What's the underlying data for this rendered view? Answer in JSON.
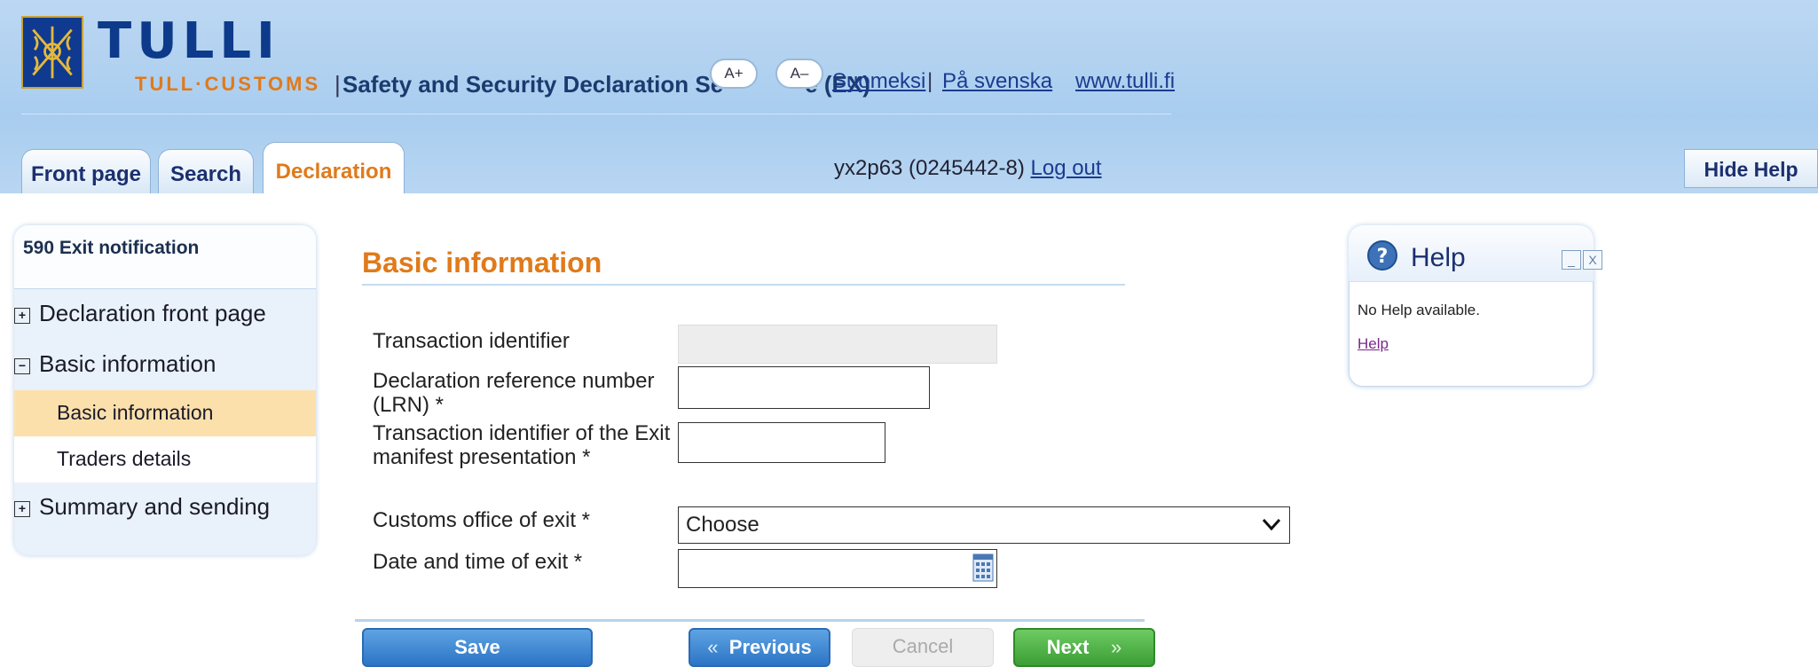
{
  "header": {
    "brand_main": "TULLI",
    "brand_sub": "TULL·CUSTOMS",
    "service_separator": "|",
    "service_title": "Safety and Security Declaration Se",
    "service_title_tail": "e (EX)",
    "font_increase_label": "A+",
    "font_decrease_label": "A–",
    "lang_finnish": "Suomeksi",
    "lang_separator": "|",
    "lang_swedish": "På svenska",
    "site_link": "www.tulli.fi"
  },
  "tabs": [
    {
      "label": "Front page"
    },
    {
      "label": "Search"
    },
    {
      "label": "Declaration"
    }
  ],
  "user": {
    "id_text": "yx2p63 (0245442-8)",
    "logout_label": "Log out"
  },
  "hide_help_label": "Hide Help",
  "sidebar": {
    "title": "590 Exit notification",
    "items": [
      {
        "label": "Declaration front page",
        "expander": "+"
      },
      {
        "label": "Basic information",
        "expander": "−"
      },
      {
        "label": "Basic information"
      },
      {
        "label": "Traders details"
      },
      {
        "label": "Summary and sending",
        "expander": "+"
      }
    ]
  },
  "form": {
    "section_title": "Basic information",
    "fields": {
      "transaction_identifier": {
        "label": "Transaction identifier",
        "value": ""
      },
      "lrn": {
        "label_line1": "Declaration reference number",
        "label_line2": "(LRN) *",
        "value": ""
      },
      "exit_manifest": {
        "label_line1": "Transaction identifier of the Exit",
        "label_line2": "manifest presentation *",
        "value": ""
      },
      "customs_office": {
        "label": "Customs office of exit *",
        "selected": "Choose"
      },
      "date_time": {
        "label": "Date and time of exit *",
        "value": ""
      }
    },
    "buttons": {
      "save": "Save",
      "previous": "Previous",
      "previous_chevron": "«",
      "cancel": "Cancel",
      "next": "Next",
      "next_chevron": "»"
    }
  },
  "help": {
    "title": "Help",
    "text": "No Help available.",
    "link": "Help",
    "minimize_symbol": "_",
    "close_symbol": "X"
  },
  "colors": {
    "header_bg": "#a9cdef",
    "brand_blue": "#0d3a8a",
    "accent_orange": "#e07a1a",
    "nav_selected": "#fce0ac",
    "button_blue": "#2c75c6",
    "button_green": "#3a9e34"
  }
}
